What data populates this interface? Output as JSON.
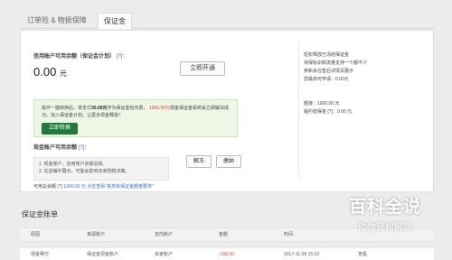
{
  "tabs": [
    {
      "label": "订单险 & 物损保障"
    },
    {
      "label": "保证金"
    }
  ],
  "credit": {
    "title": "信用账户可用余额（保证金计划）",
    "help": "[?]",
    "colon": "：",
    "amount": "0.00",
    "unit": "元",
    "open_btn": "立即开通"
  },
  "side_info_top": [
    "轻松释放已冻结保证金",
    "淘保标识和流量支持一个都不少",
    "参新会在售后详情页展示",
    "您最高可申请：0.00元"
  ],
  "side_info_bottom": [
    "额度：1000.00 元",
    "履约担保金 [?]：0.00 元"
  ],
  "promo": {
    "pre": "操作一键转换后，将支付",
    "fee": "30.00元",
    "mid": "作为保证金包年费，",
    "release": "1000.00元",
    "post": "现金保证金系统会立即解冻成功，加入保证金计划，让更多现金释放！",
    "button": "立即转换"
  },
  "cash": {
    "title": "现金账户可用余额",
    "help": "[?]",
    "colon": "："
  },
  "notes": [
    "1. 现金账户，信用账户余额总和。",
    "2. 在店铺中展示，可能会影响买家购物决策。"
  ],
  "buttons": {
    "a": "解冻",
    "b": "缴纳"
  },
  "withdraw": {
    "label": "可用总余额",
    "help": "[?]",
    "amount": "1000.00 元",
    "link": "点击查看\"各类目保证金额度要求\""
  },
  "ledger": {
    "title": "保证金账单",
    "headers": [
      "原因",
      "来源账户",
      "去向账户",
      "金额",
      "时间",
      ""
    ],
    "rows": [
      [
        "现金释付",
        "保证金现金账户",
        "买家账户",
        "-158.00",
        "2017-11-09 15:10",
        "查看"
      ]
    ]
  },
  "watermark": {
    "main": "百科全说",
    "sub": "助你轻松解决"
  }
}
